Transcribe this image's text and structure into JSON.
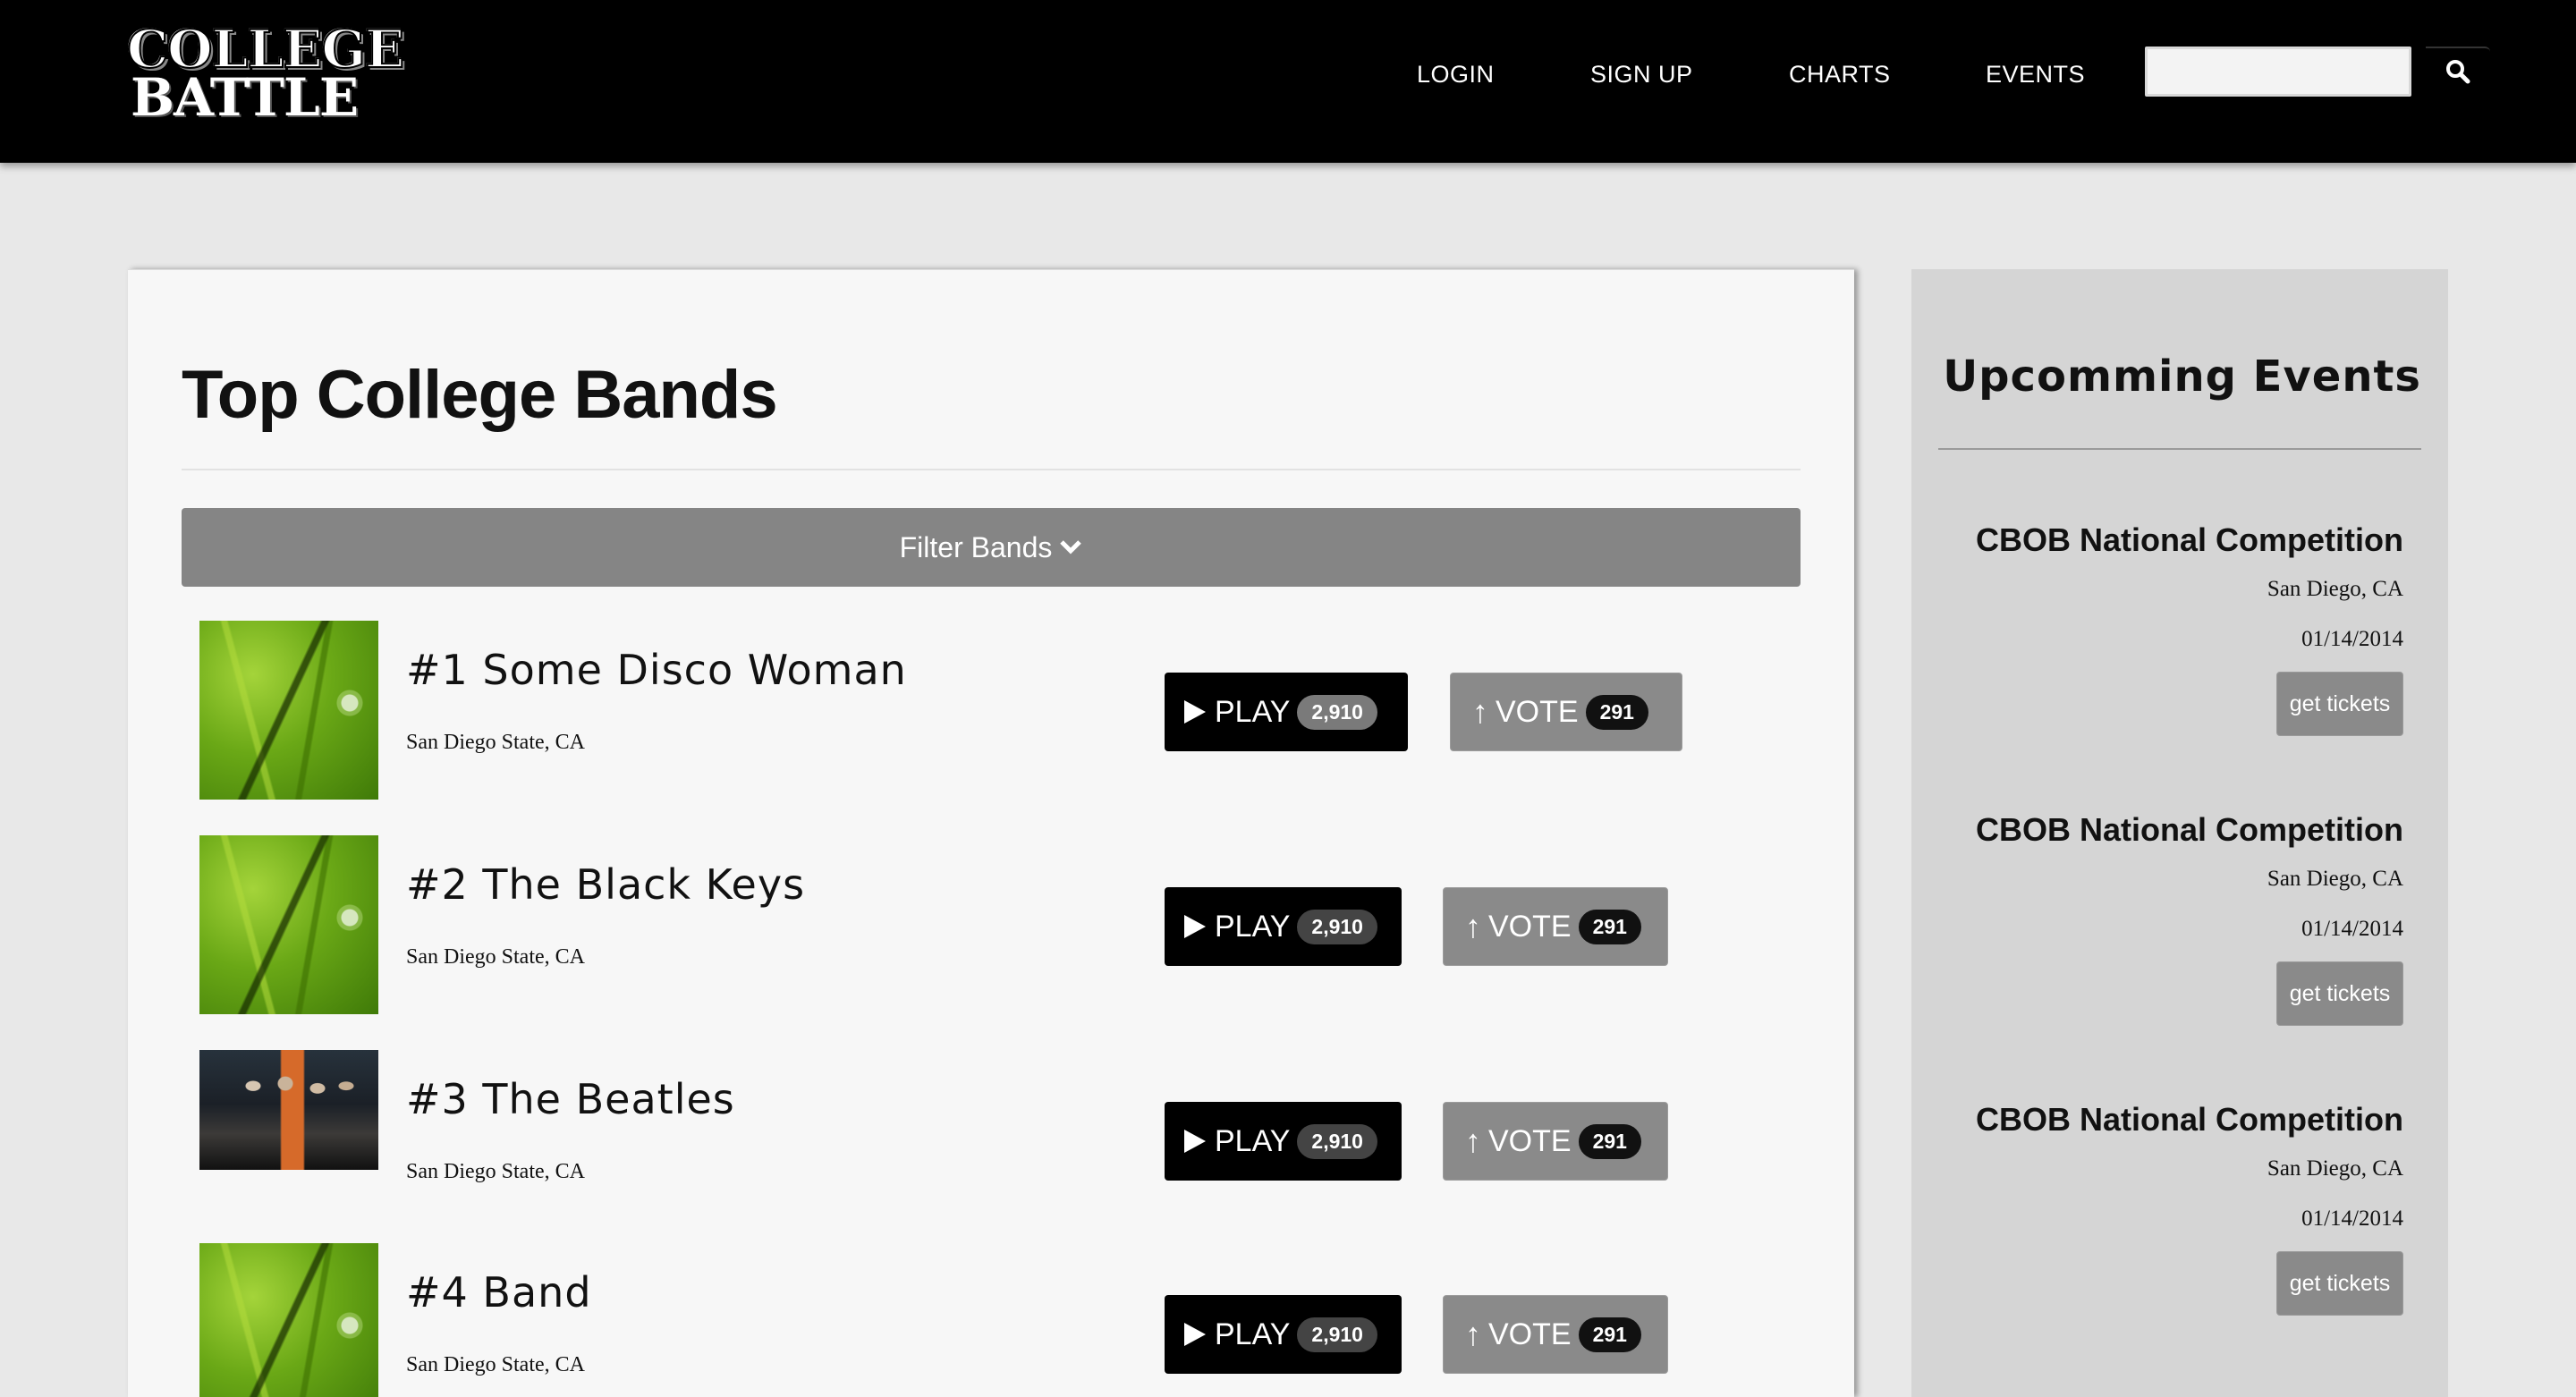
{
  "header": {
    "logo_line1": "COLLEGE",
    "logo_line2": "BATTLE",
    "nav": {
      "login": "LOGIN",
      "signup": "SIGN UP",
      "charts": "CHARTS",
      "events": "EVENTS"
    },
    "search": {
      "value": "",
      "placeholder": "",
      "icon": "search-icon"
    }
  },
  "main": {
    "title": "Top College Bands",
    "filter_label": "Filter Bands",
    "filter_icon": "chevron-down-icon",
    "bands": [
      {
        "name": "#1 Some Disco Woman",
        "location": "San Diego State, CA",
        "play_label": "PLAY",
        "play_count": "2,910",
        "vote_label": "VOTE",
        "vote_count": "291",
        "image": "grass"
      },
      {
        "name": "#2 The Black Keys",
        "location": "San Diego State, CA",
        "play_label": "PLAY",
        "play_count": "2,910",
        "vote_label": "VOTE",
        "vote_count": "291",
        "image": "grass"
      },
      {
        "name": "#3 The Beatles",
        "location": "San Diego State, CA",
        "play_label": "PLAY",
        "play_count": "2,910",
        "vote_label": "VOTE",
        "vote_count": "291",
        "image": "band-photo"
      },
      {
        "name": "#4 Band",
        "location": "San Diego State, CA",
        "play_label": "PLAY",
        "play_count": "2,910",
        "vote_label": "VOTE",
        "vote_count": "291",
        "image": "grass"
      }
    ]
  },
  "sidebar": {
    "title": "Upcomming Events",
    "events": [
      {
        "name": "CBOB National Competition",
        "location": "San Diego, CA",
        "date": "01/14/2014",
        "button": "get tickets"
      },
      {
        "name": "CBOB National Competition",
        "location": "San Diego, CA",
        "date": "01/14/2014",
        "button": "get tickets"
      },
      {
        "name": "CBOB National Competition",
        "location": "San Diego, CA",
        "date": "01/14/2014",
        "button": "get tickets"
      }
    ]
  },
  "colors": {
    "header_bg": "#000000",
    "page_bg": "#e8e8e8",
    "panel_bg": "#f7f7f7",
    "sidebar_bg": "#d5d5d5",
    "filter_bg": "#858585",
    "vote_bg": "#8a8a8a"
  }
}
